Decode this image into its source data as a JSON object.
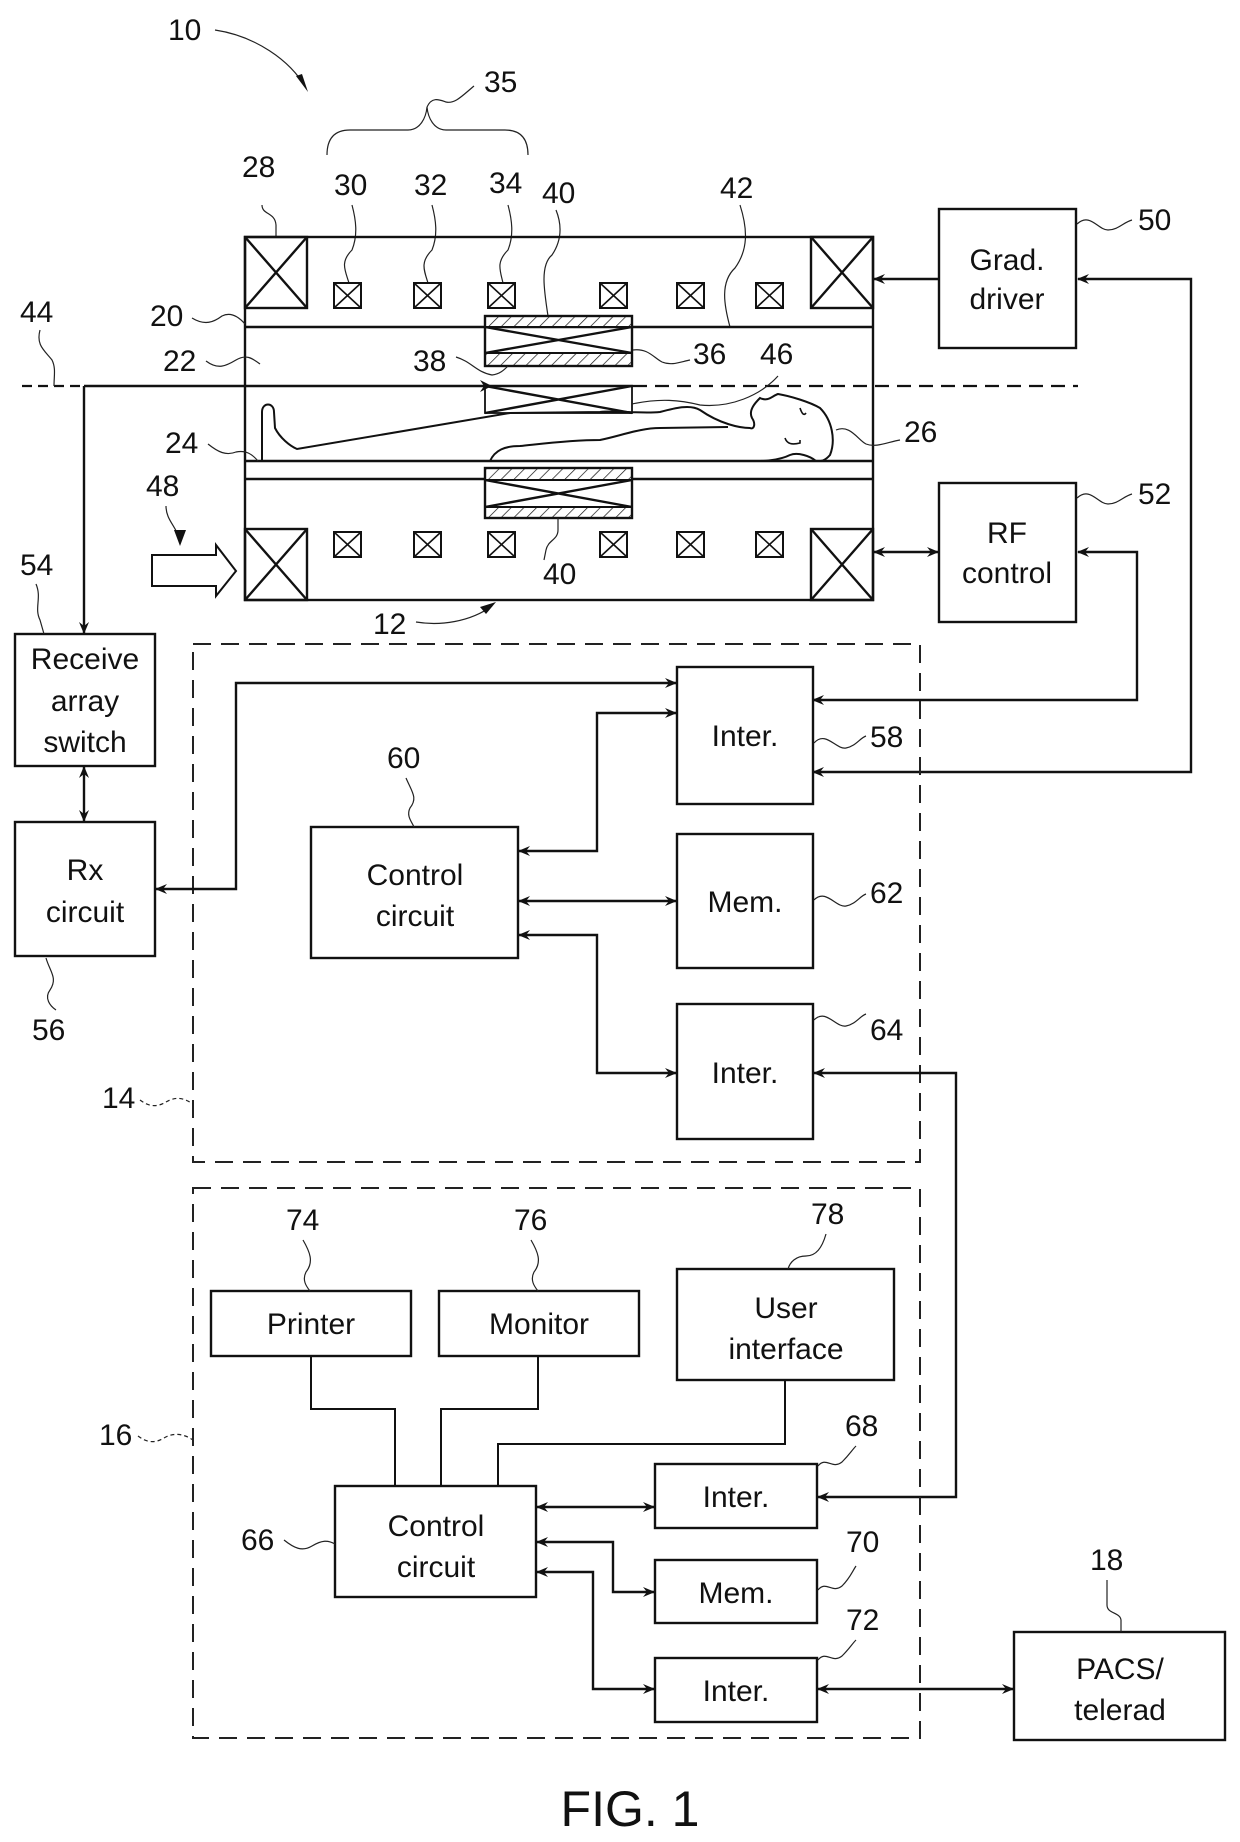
{
  "figure": {
    "caption": "FIG. 1",
    "system_ref": "10",
    "scanner_ref": "12",
    "gradient_group_ref": "35"
  },
  "scanner_labels": {
    "l20": "20",
    "l22": "22",
    "l24": "24",
    "l26": "26",
    "l28": "28",
    "l30": "30",
    "l32": "32",
    "l34": "34",
    "l36": "36",
    "l38": "38",
    "l40_top": "40",
    "l40_bottom": "40",
    "l42": "42",
    "l44": "44",
    "l46": "46",
    "l48": "48"
  },
  "blocks": {
    "grad_driver": {
      "ref": "50",
      "line1": "Grad.",
      "line2": "driver"
    },
    "rf_control": {
      "ref": "52",
      "line1": "RF",
      "line2": "control"
    },
    "receive_switch": {
      "ref": "54",
      "line1": "Receive",
      "line2": "array",
      "line3": "switch"
    },
    "rx_circuit": {
      "ref": "56",
      "line1": "Rx",
      "line2": "circuit"
    },
    "scanner_control_group": {
      "ref": "14"
    },
    "inter_58": {
      "ref": "58",
      "label": "Inter."
    },
    "control_60": {
      "ref": "60",
      "line1": "Control",
      "line2": "circuit"
    },
    "mem_62": {
      "ref": "62",
      "label": "Mem."
    },
    "inter_64": {
      "ref": "64",
      "label": "Inter."
    },
    "operator_group": {
      "ref": "16"
    },
    "control_66": {
      "ref": "66",
      "line1": "Control",
      "line2": "circuit"
    },
    "inter_68": {
      "ref": "68",
      "label": "Inter."
    },
    "mem_70": {
      "ref": "70",
      "label": "Mem."
    },
    "inter_72": {
      "ref": "72",
      "label": "Inter."
    },
    "printer": {
      "ref": "74",
      "label": "Printer"
    },
    "monitor": {
      "ref": "76",
      "label": "Monitor"
    },
    "user_interface": {
      "ref": "78",
      "line1": "User",
      "line2": "interface"
    },
    "pacs": {
      "ref": "18",
      "line1": "PACS/",
      "line2": "telerad"
    }
  }
}
